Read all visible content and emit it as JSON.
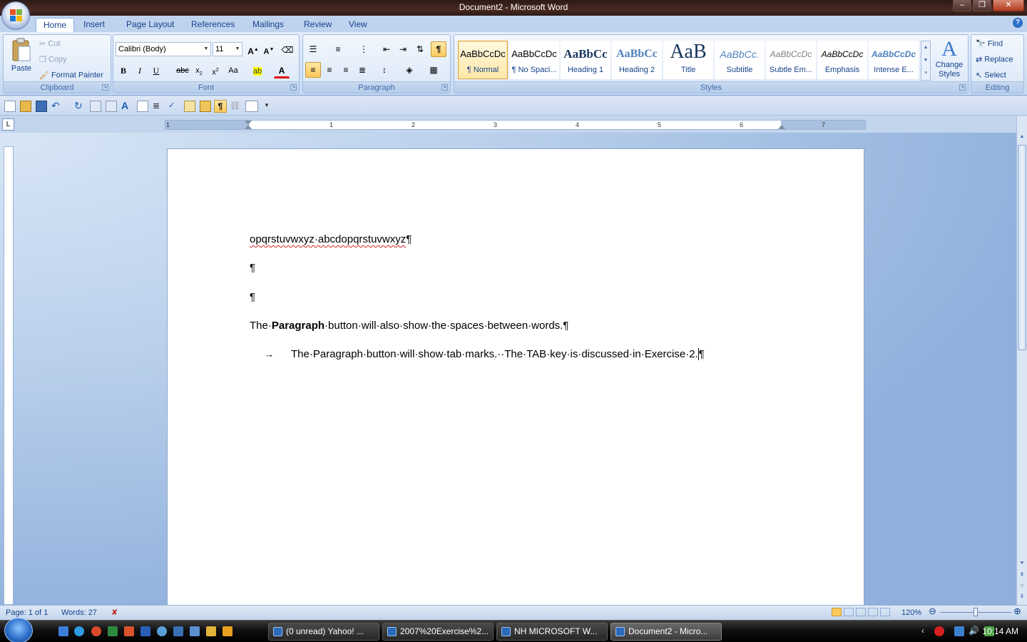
{
  "window": {
    "title": "Document2 - Microsoft Word"
  },
  "tabs": [
    "Home",
    "Insert",
    "Page Layout",
    "References",
    "Mailings",
    "Review",
    "View"
  ],
  "clipboard": {
    "paste": "Paste",
    "cut": "Cut",
    "copy": "Copy",
    "format_painter": "Format Painter",
    "label": "Clipboard"
  },
  "font": {
    "name": "Calibri (Body)",
    "size": "11",
    "label": "Font"
  },
  "paragraph": {
    "label": "Paragraph"
  },
  "styles": {
    "label": "Styles",
    "items": [
      {
        "sample": "AaBbCcDc",
        "name": "¶ Normal"
      },
      {
        "sample": "AaBbCcDc",
        "name": "¶ No Spaci..."
      },
      {
        "sample": "AaBbCc",
        "name": "Heading 1"
      },
      {
        "sample": "AaBbCc",
        "name": "Heading 2"
      },
      {
        "sample": "AaB",
        "name": "Title"
      },
      {
        "sample": "AaBbCc.",
        "name": "Subtitle"
      },
      {
        "sample": "AaBbCcDc",
        "name": "Subtle Em..."
      },
      {
        "sample": "AaBbCcDc",
        "name": "Emphasis"
      },
      {
        "sample": "AaBbCcDc",
        "name": "Intense E..."
      }
    ],
    "change_styles_line1": "Change",
    "change_styles_line2": "Styles"
  },
  "editing": {
    "find": "Find",
    "replace": "Replace",
    "select": "Select",
    "label": "Editing"
  },
  "ruler": {
    "numbers": [
      "1",
      "1",
      "2",
      "3",
      "4",
      "5",
      "6",
      "7"
    ]
  },
  "document": {
    "line1": "opqrstuvwxyz·abcdopqrstuvwxyz",
    "pilcrow": "¶",
    "line4_a": "The·",
    "line4_bold": "Paragraph",
    "line4_b": "·button·will·also·show·the·spaces·between·words.",
    "line5_arrow": "→",
    "line5": "The·Paragraph·button·will·show·tab·marks.··The·TAB·key·is·discussed·in·Exercise·2."
  },
  "status": {
    "page": "Page: 1 of 1",
    "words": "Words: 27",
    "zoom": "120%"
  },
  "taskbar": {
    "buttons": [
      "(0 unread) Yahoo! ...",
      "2007%20Exercise%2...",
      "NH MICROSOFT W...",
      "Document2 - Micro..."
    ],
    "clock": "10:14 AM"
  }
}
